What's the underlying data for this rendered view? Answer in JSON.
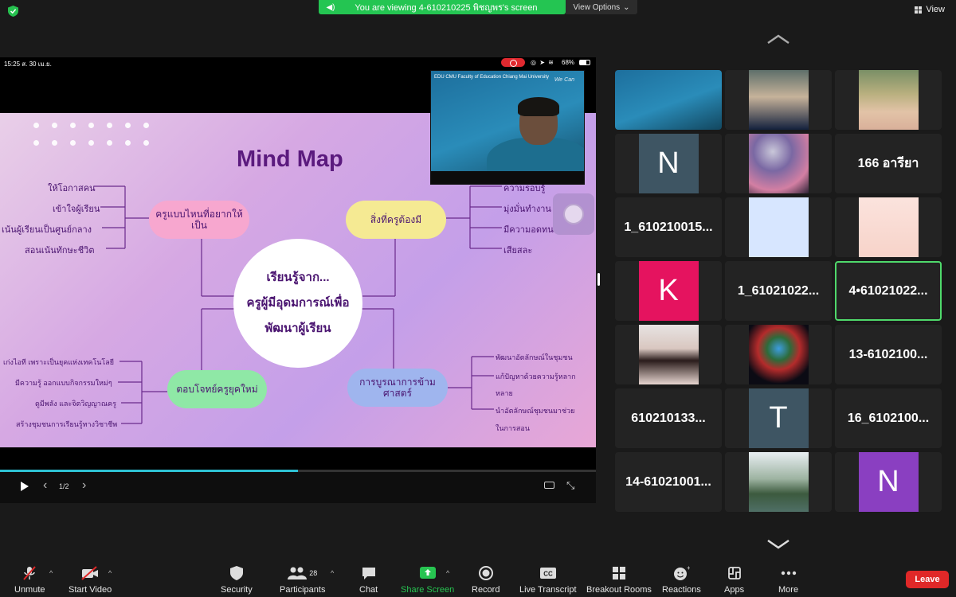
{
  "top": {
    "banner_text": "You are viewing 4-610210225 พิชญพร's screen",
    "view_options": "View Options",
    "view": "View"
  },
  "share": {
    "status_time": "15:25  ส. 30 เม.ย.",
    "battery": "68%",
    "page_indicator": "1/2",
    "progress_fraction": 0.5
  },
  "slide": {
    "title": "Mind Map",
    "center_lines": [
      "เรียนรู้จาก...",
      "ครูผู้มีอุดมการณ์เพื่อ",
      "พัฒนาผู้เรียน"
    ],
    "node1": "ครูแบบไหนที่อยากให้เป็น",
    "node2": "สิ่งที่ครูต้องมี",
    "node3": "ตอบโจทย์ครูยุคใหม่",
    "node4": "การบูรณาการข้ามศาสตร์",
    "left_top_leaves": [
      "ให้โอกาสคน",
      "เข้าใจผู้เรียน",
      "เน้นผู้เรียนเป็นศูนย์กลาง",
      "สอนเน้นทักษะชีวิต"
    ],
    "right_top_leaves": [
      "ความรอบรู้",
      "มุ่งมั่นทำงาน",
      "มีความอดทน",
      "เสียสละ"
    ],
    "left_bottom_leaves": [
      "เก่งไอที เพราะเป็นยุคแห่งเทคโนโลยี",
      "มีความรู้ ออกแบบกิจกรรมใหม่ๆ",
      "ดูมีพลัง และจิตวิญญาณครู",
      "สร้างชุมชนการเรียนรู้ทางวิชาชีพ"
    ],
    "right_bottom_leaves": [
      "พัฒนาอัตลักษณ์ในชุมชน",
      "แก้ปัญหาด้วยความรู้หลาก",
      "หลาย",
      "นำอัตลักษณ์ชุมชนมาช่วย",
      "ในการสอน"
    ]
  },
  "pip": {
    "logo": "EDU CMU Faculty of Education Chiang Mai University",
    "sign": "We Can"
  },
  "participants": [
    {
      "type": "video",
      "label": "cmu-video"
    },
    {
      "type": "photo",
      "label": "graduation-photo"
    },
    {
      "type": "photo",
      "label": "woman-photo"
    },
    {
      "type": "letter",
      "letter": "N",
      "color": "#3e5563"
    },
    {
      "type": "photo",
      "label": "moon-photo"
    },
    {
      "type": "name",
      "name": "166 อารียา"
    },
    {
      "type": "name",
      "name": "1_610210015..."
    },
    {
      "type": "photo",
      "label": "cartoon-photo"
    },
    {
      "type": "photo",
      "label": "illustration-photo"
    },
    {
      "type": "letter",
      "letter": "K",
      "color": "#e5135f"
    },
    {
      "type": "name",
      "name": "1_61021022..."
    },
    {
      "type": "name",
      "name": "4•61021022...",
      "active": true
    },
    {
      "type": "photo",
      "label": "girl-photo"
    },
    {
      "type": "photo",
      "label": "insideout-photo"
    },
    {
      "type": "name",
      "name": "13-6102100..."
    },
    {
      "type": "name",
      "name": "610210133..."
    },
    {
      "type": "letter",
      "letter": "T",
      "color": "#3e5563"
    },
    {
      "type": "name",
      "name": "16_6102100..."
    },
    {
      "type": "name",
      "name": "14-61021001..."
    },
    {
      "type": "photo",
      "label": "landscape-photo"
    },
    {
      "type": "letter",
      "letter": "N",
      "color": "#8a3fc1"
    }
  ],
  "toolbar": {
    "unmute": "Unmute",
    "start_video": "Start Video",
    "security": "Security",
    "participants": "Participants",
    "participants_count": "28",
    "chat": "Chat",
    "share_screen": "Share Screen",
    "record": "Record",
    "live_transcript": "Live Transcript",
    "breakout_rooms": "Breakout Rooms",
    "reactions": "Reactions",
    "apps": "Apps",
    "more": "More",
    "leave": "Leave"
  },
  "colors": {
    "accent_green": "#24c552",
    "leave_red": "#e02828",
    "slide_title": "#5b1a7e"
  }
}
